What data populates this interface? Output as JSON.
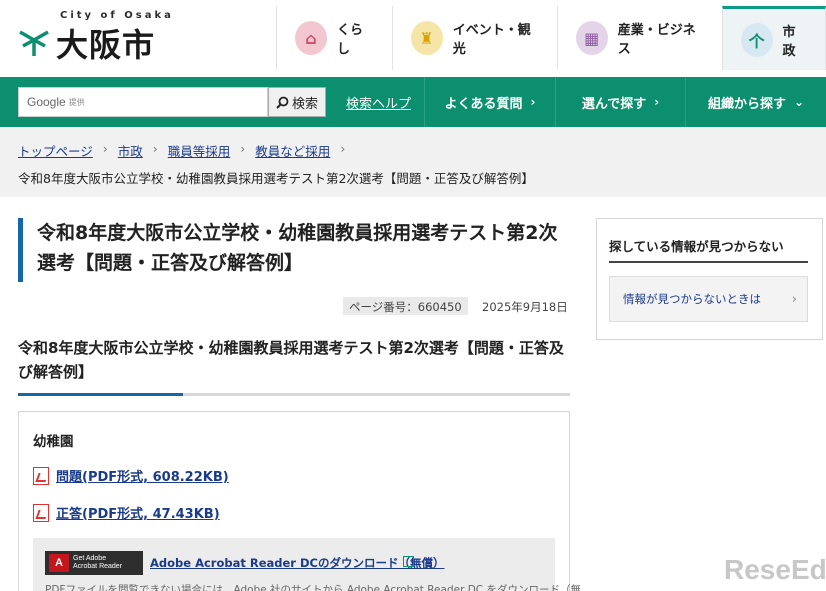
{
  "header": {
    "logo_en": "City of Osaka",
    "logo_ja": "大阪市",
    "nav": [
      {
        "label": "くらし",
        "icon": "house-icon",
        "color": "#f3c7cf",
        "glyph": "⌂"
      },
      {
        "label": "イベント・観光",
        "icon": "castle-icon",
        "color": "#f5e6a8",
        "glyph": "♜"
      },
      {
        "label": "産業・ビジネス",
        "icon": "building-icon",
        "color": "#e4d4ea",
        "glyph": "▦"
      },
      {
        "label": "市政",
        "icon": "city-emblem-icon",
        "color": "#d8e8f2",
        "glyph": "个"
      }
    ]
  },
  "search": {
    "brand": "Google",
    "brand_sub": "提供",
    "button_label": "検索",
    "help_link": "検索ヘルプ"
  },
  "menu": [
    {
      "label": "よくある質問",
      "chev": "›"
    },
    {
      "label": "選んで探す",
      "chev": "›"
    },
    {
      "label": "組織から探す",
      "chev": "⌄"
    }
  ],
  "breadcrumb": {
    "items": [
      "トップページ",
      "市政",
      "職員等採用",
      "教員など採用"
    ],
    "separator": "›",
    "current": "令和8年度大阪市公立学校・幼稚園教員採用選考テスト第2次選考【問題・正答及び解答例】"
  },
  "article": {
    "title": "令和8年度大阪市公立学校・幼稚園教員採用選考テスト第2次選考【問題・正答及び解答例】",
    "page_number": "ページ番号：660450",
    "date": "2025年9月18日",
    "heading": "令和8年度大阪市公立学校・幼稚園教員採用選考テスト第2次選考【問題・正答及び解答例】",
    "section_title": "幼稚園",
    "files": [
      {
        "label": "問題(PDF形式, 608.22KB)"
      },
      {
        "label": "正答(PDF形式, 47.43KB)"
      }
    ],
    "acrobat": {
      "badge_line1": "Get Adobe",
      "badge_line2": "Acrobat Reader",
      "link": "Adobe Acrobat Reader DCのダウンロード（無償）",
      "text": "PDFファイルを閲覧できない場合には、Adobe 社のサイトから Adobe Acrobat Reader DC をダウンロード（無"
    }
  },
  "sidebar": {
    "heading": "探している情報が見つからない",
    "button": "情報が見つからないときは",
    "chev": "›"
  },
  "watermark": "ReseEd"
}
